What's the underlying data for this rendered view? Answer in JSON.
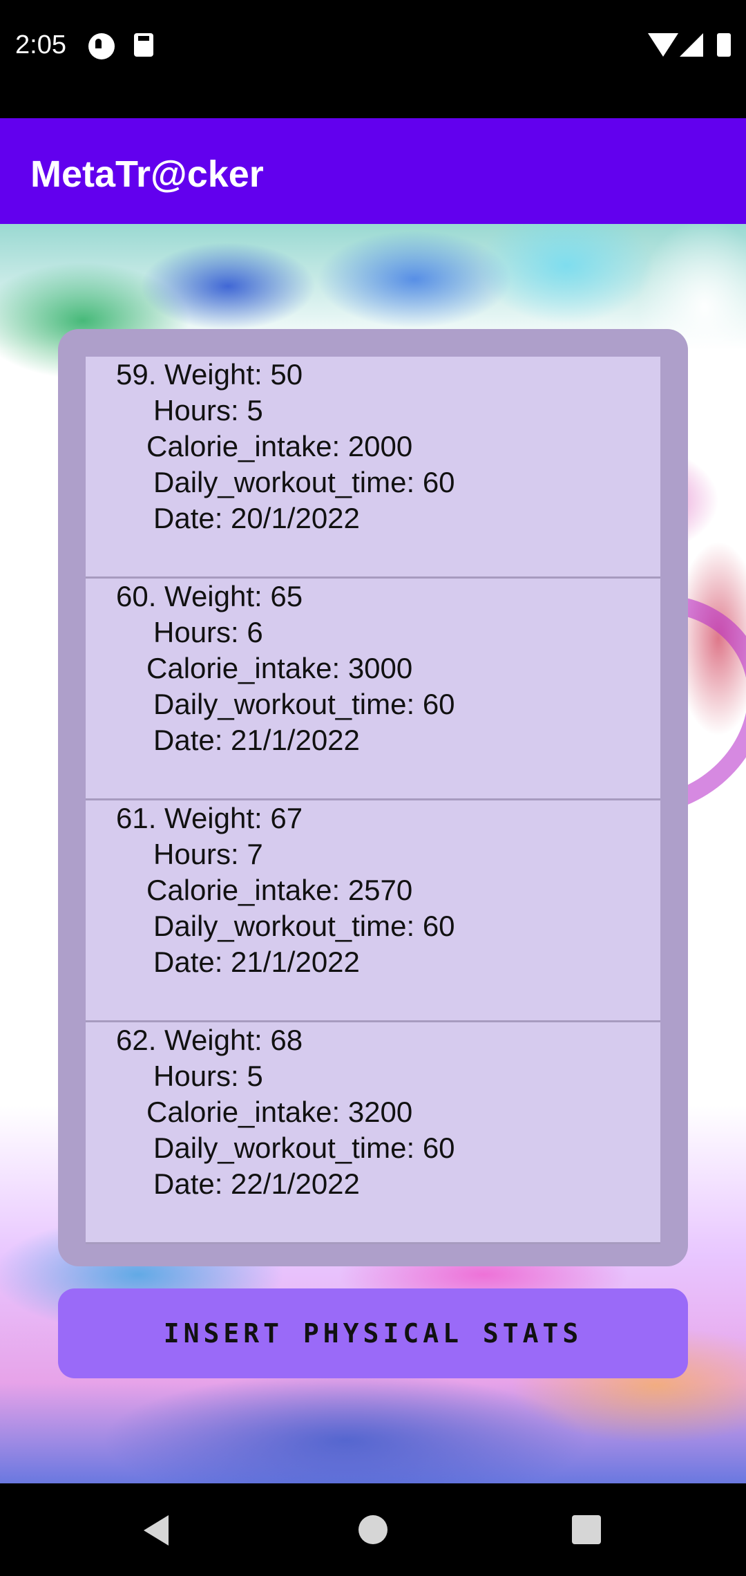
{
  "status_bar": {
    "time": "2:05",
    "icons": [
      "notification-icon",
      "sd-card-icon",
      "wifi-icon",
      "signal-icon",
      "battery-icon"
    ]
  },
  "app_bar": {
    "title": "MetaTr@cker"
  },
  "records": [
    {
      "weight": "59. Weight: 50",
      "hours": "Hours:  5",
      "calorie": "Calorie_intake: 2000",
      "workout": "Daily_workout_time: 60",
      "date": "Date:  20/1/2022"
    },
    {
      "weight": "60. Weight: 65",
      "hours": "Hours:  6",
      "calorie": "Calorie_intake: 3000",
      "workout": "Daily_workout_time: 60",
      "date": "Date:  21/1/2022"
    },
    {
      "weight": "61. Weight: 67",
      "hours": "Hours:  7",
      "calorie": "Calorie_intake: 2570",
      "workout": "Daily_workout_time: 60",
      "date": "Date:  21/1/2022"
    },
    {
      "weight": "62. Weight: 68",
      "hours": "Hours:  5",
      "calorie": "Calorie_intake: 3200",
      "workout": "Daily_workout_time: 60",
      "date": "Date:  22/1/2022"
    }
  ],
  "insert_button": {
    "label": "INSERT PHYSICAL STATS"
  },
  "nav_bar": {
    "icons": [
      "back-icon",
      "home-icon",
      "recents-icon"
    ]
  },
  "colors": {
    "app_bar": "#6200ee",
    "button": "#9a6af8",
    "list_bg": "#d6cbee",
    "card_bg": "#ae9fca"
  }
}
